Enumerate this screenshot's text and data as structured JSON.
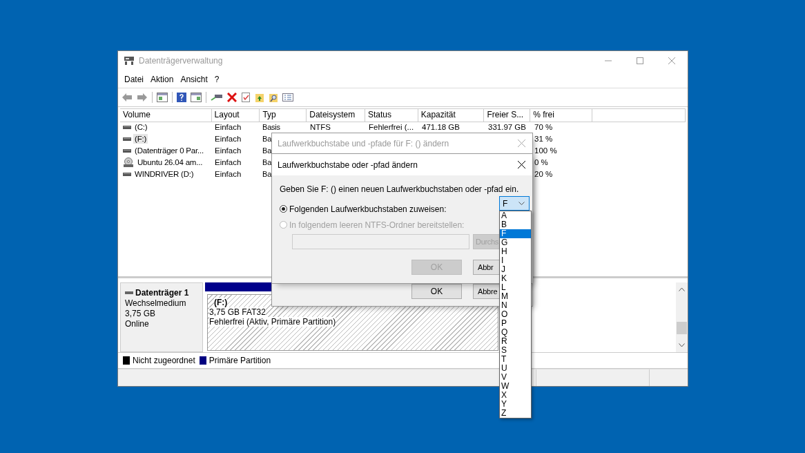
{
  "window": {
    "title": "Datenträgerverwaltung",
    "active": false
  },
  "menu": [
    "Datei",
    "Aktion",
    "Ansicht",
    "?"
  ],
  "table": {
    "columns": [
      "Volume",
      "Layout",
      "Typ",
      "Dateisystem",
      "Status",
      "Kapazität",
      "Freier S...",
      "% frei"
    ],
    "rows": [
      {
        "kind": "drive",
        "selected": false,
        "cells": {
          "volume": "(C:)",
          "layout": "Einfach",
          "typ": "Basis",
          "dateisystem": "NTFS",
          "status": "Fehlerfrei (...",
          "kapazitaet": "471.18 GB",
          "freier": "331.97 GB",
          "frei": "70 %"
        }
      },
      {
        "kind": "drive",
        "selected": true,
        "cells": {
          "volume": "(F:)",
          "layout": "Einfach",
          "typ": "Ba",
          "frei": "31 %"
        }
      },
      {
        "kind": "drive",
        "selected": false,
        "cells": {
          "volume": "(Datenträger 0 Par...",
          "layout": "Einfach",
          "typ": "Ba",
          "frei": "100 %"
        }
      },
      {
        "kind": "disc",
        "selected": false,
        "cells": {
          "volume": "Ubuntu 26.04 am...",
          "layout": "Einfach",
          "typ": "Ba",
          "frei": "0 %"
        }
      },
      {
        "kind": "drive",
        "selected": false,
        "cells": {
          "volume": "WINDRIVER (D:)",
          "layout": "Einfach",
          "typ": "Ba",
          "frei": "20 %"
        }
      }
    ]
  },
  "disk": {
    "name": "Datenträger 1",
    "type": "Wechselmedium",
    "size": "3,75 GB",
    "state": "Online",
    "partition": {
      "label": "(F:)",
      "info": "3,75 GB FAT32",
      "status": "Fehlerfrei (Aktiv, Primäre Partition)"
    }
  },
  "legend": [
    {
      "label": "Nicht zugeordnet",
      "color": "#000000"
    },
    {
      "label": "Primäre Partition",
      "color": "#000080"
    }
  ],
  "back_dialog": {
    "title": "Laufwerkbuchstabe und -pfade für F: () ändern",
    "active": false,
    "buttons": [
      {
        "label": "OK"
      },
      {
        "label": "Abbre"
      }
    ]
  },
  "dialog": {
    "title": "Laufwerkbuchstabe oder -pfad ändern",
    "active": true,
    "prompt": "Geben Sie F: () einen neuen Laufwerkbuchstaben oder -pfad ein.",
    "options": [
      {
        "label": "Folgenden Laufwerkbuchstaben zuweisen:",
        "selected": true,
        "disabled": false
      },
      {
        "label": "In folgendem leeren NTFS-Ordner bereitstellen:",
        "selected": false,
        "disabled": true
      }
    ],
    "folder_field": {
      "disabled": true
    },
    "browse_button": {
      "label": "Durchs",
      "disabled": true
    },
    "buttons": [
      {
        "label": "OK",
        "disabled": true
      },
      {
        "label": "Abbr",
        "disabled": false
      }
    ],
    "drive_letter": {
      "value": "F",
      "expanded": true,
      "options": [
        {
          "label": "A",
          "selected": false
        },
        {
          "label": "B",
          "selected": false
        },
        {
          "label": "F",
          "selected": true
        },
        {
          "label": "G",
          "selected": false
        },
        {
          "label": "H",
          "selected": false
        },
        {
          "label": "I",
          "selected": false
        },
        {
          "label": "J",
          "selected": false
        },
        {
          "label": "K",
          "selected": false
        },
        {
          "label": "L",
          "selected": false
        },
        {
          "label": "M",
          "selected": false
        },
        {
          "label": "N",
          "selected": false
        },
        {
          "label": "O",
          "selected": false
        },
        {
          "label": "P",
          "selected": false
        },
        {
          "label": "Q",
          "selected": false
        },
        {
          "label": "R",
          "selected": false
        },
        {
          "label": "S",
          "selected": false
        },
        {
          "label": "T",
          "selected": false
        },
        {
          "label": "U",
          "selected": false
        },
        {
          "label": "V",
          "selected": false
        },
        {
          "label": "W",
          "selected": false
        },
        {
          "label": "X",
          "selected": false
        },
        {
          "label": "Y",
          "selected": false
        },
        {
          "label": "Z",
          "selected": false
        }
      ]
    }
  }
}
